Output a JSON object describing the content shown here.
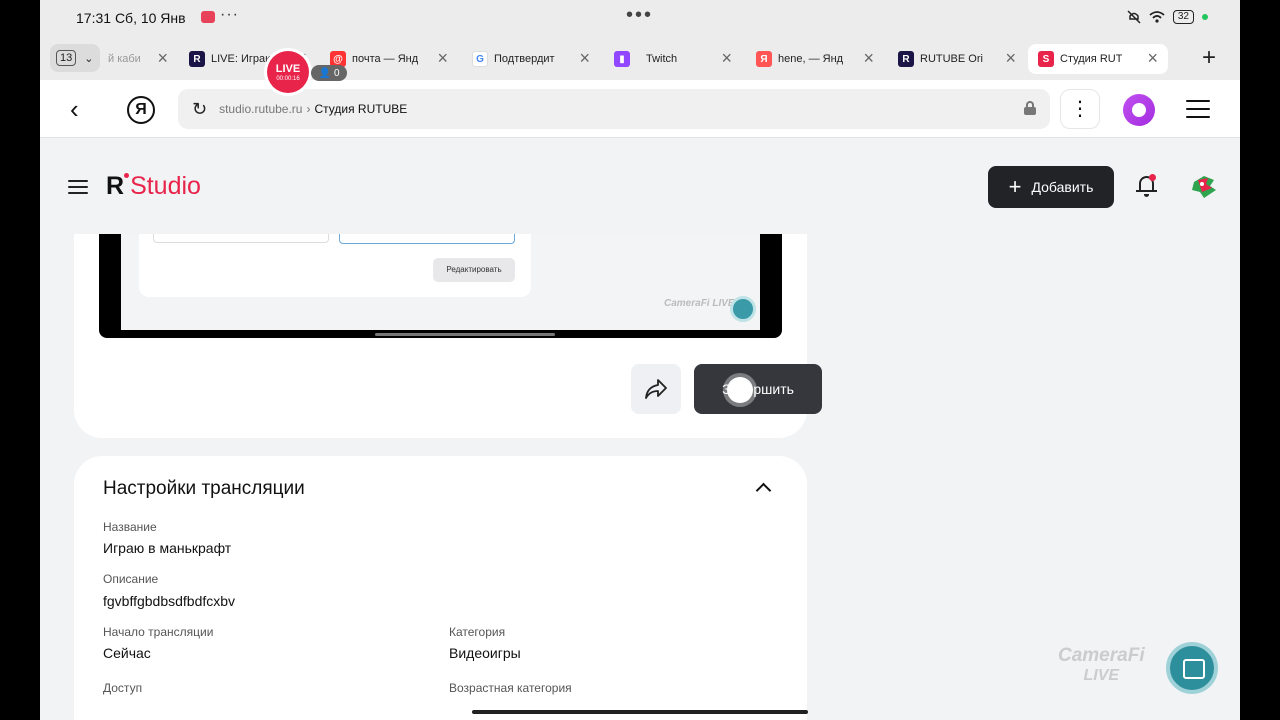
{
  "status_bar": {
    "time": "17:31",
    "date": "Сб, 10 Янв",
    "battery": "32"
  },
  "tabs": {
    "count": "13",
    "items": [
      {
        "label": "й каби",
        "favicon": "none"
      },
      {
        "label": "LIVE: Играю",
        "favicon": "rutube"
      },
      {
        "label": "почта — Янд",
        "favicon": "yandex-mail"
      },
      {
        "label": "Подтвердит",
        "favicon": "google"
      },
      {
        "label": "Twitch",
        "favicon": "twitch"
      },
      {
        "label": "hene, — Янд",
        "favicon": "yandex"
      },
      {
        "label": "RUTUBE Ori",
        "favicon": "rutube"
      },
      {
        "label": "Студия RUT",
        "favicon": "studio",
        "active": true
      }
    ]
  },
  "live_overlay": {
    "label": "LIVE",
    "timer": "00:00:16",
    "viewers": "0"
  },
  "address_bar": {
    "host": "studio.rutube.ru",
    "separator": "›",
    "page_title": "Студия RUTUBE"
  },
  "studio": {
    "logo_r": "R",
    "logo_text": "Studio",
    "add_button": "Добавить",
    "accent_color": "#e8244b"
  },
  "preview": {
    "edit_label": "Редактировать",
    "watermark": "CameraFi LIVE"
  },
  "actions": {
    "finish_label": "Завершить"
  },
  "settings": {
    "title": "Настройки трансляции",
    "fields": {
      "name_label": "Название",
      "name_value": "Играю в манькрафт",
      "desc_label": "Описание",
      "desc_value": "fgvbffgbdbsdfbdfcxbv",
      "start_label": "Начало трансляции",
      "start_value": "Сейчас",
      "category_label": "Категория",
      "category_value": "Видеоигры",
      "access_label": "Доступ",
      "age_label": "Возрастная категория"
    }
  },
  "camera_watermark": {
    "line1": "CameraFi",
    "line2": "LIVE"
  }
}
